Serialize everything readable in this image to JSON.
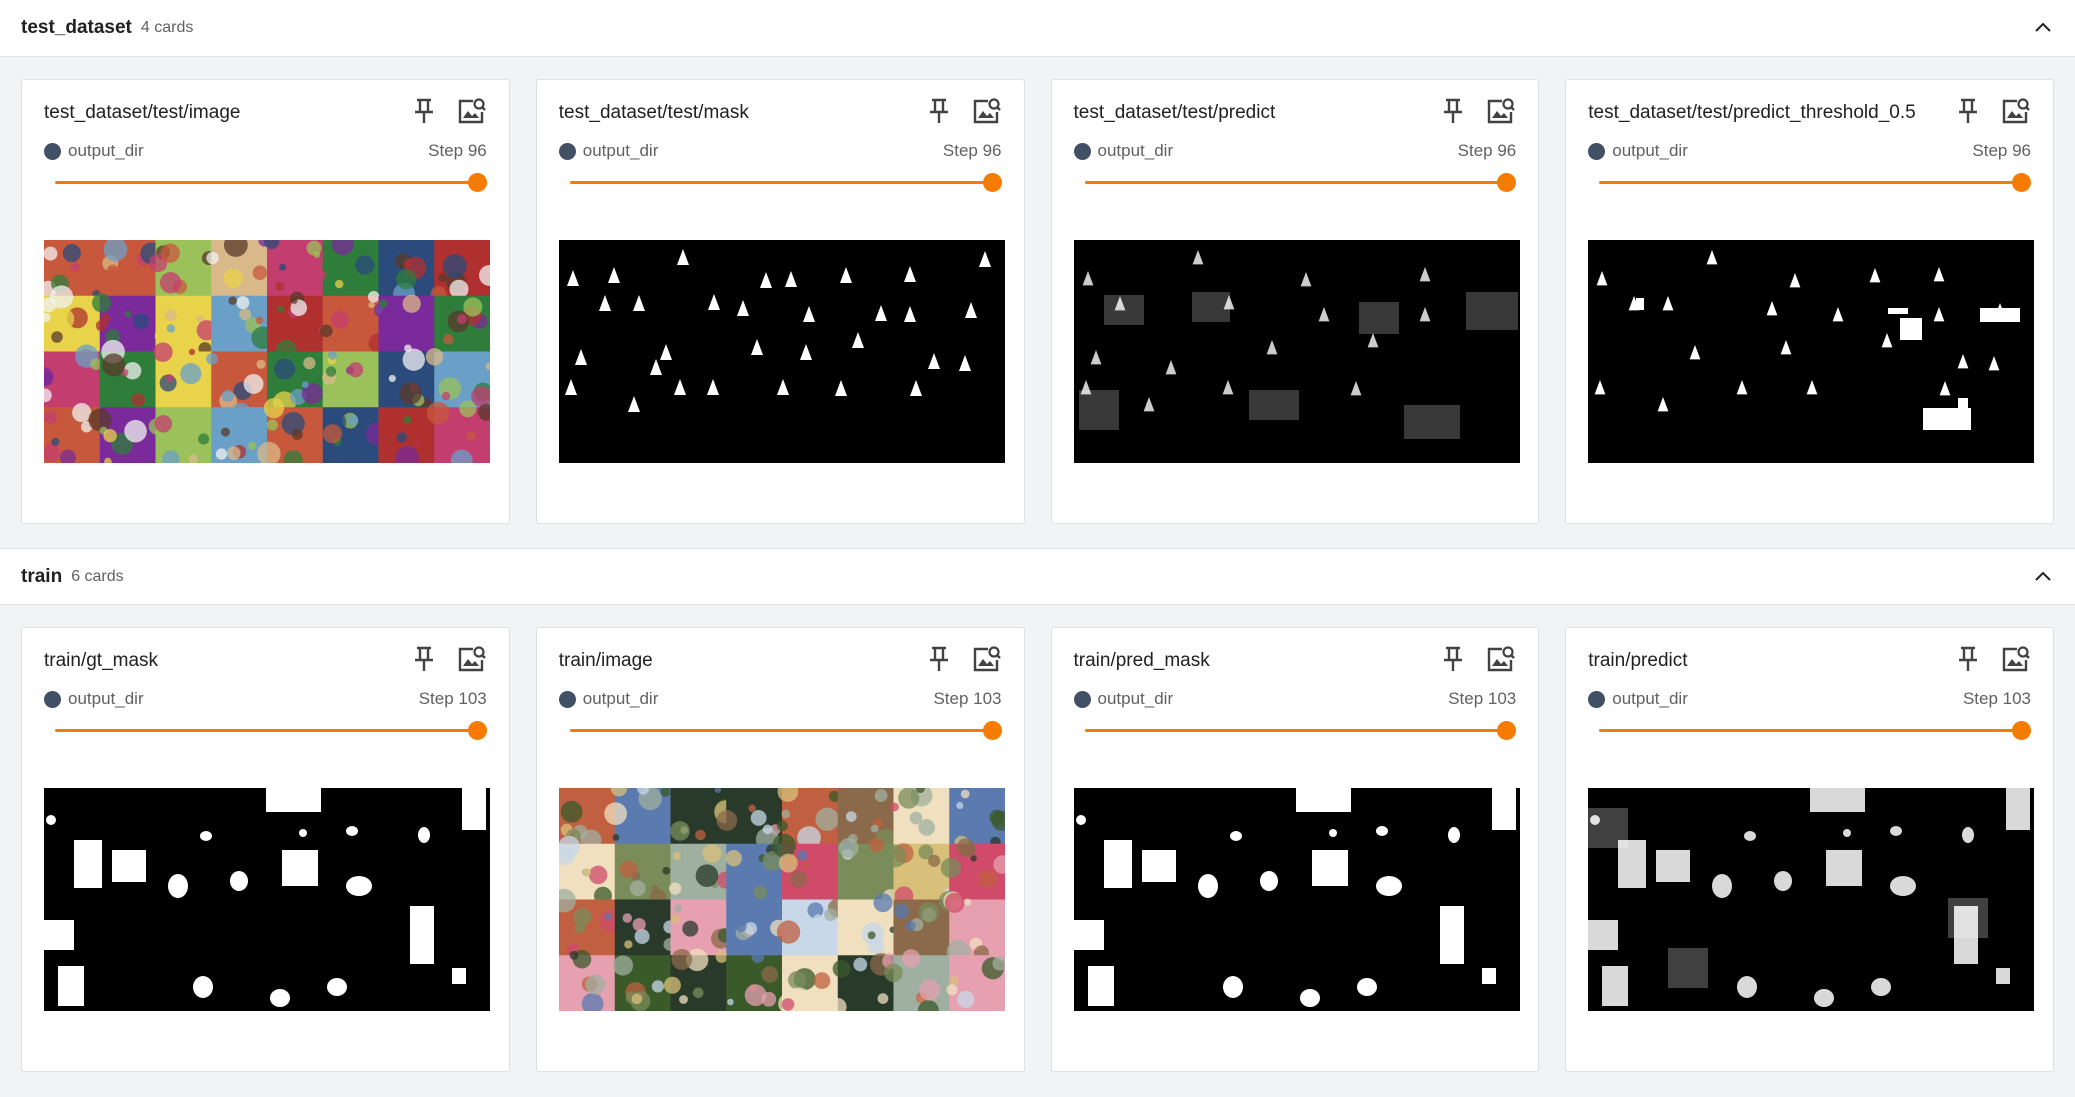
{
  "groups": [
    {
      "title": "test_dataset",
      "count": "4 cards",
      "cards": [
        {
          "title": "test_dataset/test/image",
          "run": "output_dir",
          "step": "Step 96",
          "image": "texture-collage"
        },
        {
          "title": "test_dataset/test/mask",
          "run": "output_dir",
          "step": "Step 96",
          "image": "triangle-mask"
        },
        {
          "title": "test_dataset/test/predict",
          "run": "output_dir",
          "step": "Step 96",
          "image": "predicted-mask"
        },
        {
          "title": "test_dataset/test/predict_threshold_0.5",
          "run": "output_dir",
          "step": "Step 96",
          "image": "thresholded-mask"
        }
      ]
    },
    {
      "title": "train",
      "count": "6 cards",
      "cards": [
        {
          "title": "train/gt_mask",
          "run": "output_dir",
          "step": "Step 103",
          "image": "gt-mask"
        },
        {
          "title": "train/image",
          "run": "output_dir",
          "step": "Step 103",
          "image": "photo-collage"
        },
        {
          "title": "train/pred_mask",
          "run": "output_dir",
          "step": "Step 103",
          "image": "pred-mask"
        },
        {
          "title": "train/predict",
          "run": "output_dir",
          "step": "Step 103",
          "image": "predict-map"
        }
      ]
    }
  ],
  "colors": {
    "accent": "#f57c00",
    "run": "#425066"
  },
  "icons": {
    "pin": "pin-icon",
    "zoom": "image-search-icon",
    "collapse": "chevron-up-icon"
  },
  "slider_position": 1.0
}
